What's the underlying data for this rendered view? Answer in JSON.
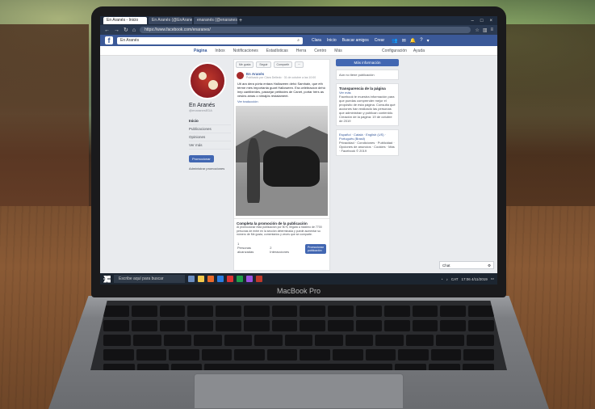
{
  "browser": {
    "tabs": [
      {
        "label": "En Aranés - Inicio",
        "active": true
      },
      {
        "label": "En Aranés (@EnAranes) / Twi…",
        "active": false
      },
      {
        "label": "enaranés (@enaranes) • Inst…",
        "active": false
      }
    ],
    "new_tab": "+",
    "url": "https://www.facebook.com/enaranes/",
    "controls": [
      "–",
      "□",
      "×"
    ]
  },
  "facebook": {
    "logo": "f",
    "search_value": "En Aranés",
    "nav": [
      "Clara",
      "Inicio",
      "Buscar amigos",
      "Crear"
    ],
    "page_tabs": [
      "Página",
      "Inbox",
      "Notificaciones",
      "Estadísticas",
      "Herramientas de publicación",
      "Más"
    ],
    "page_tabs_short": [
      "Página",
      "Inbox",
      "Notificaciones",
      "Estadísticas",
      "Herra",
      "Centro",
      "Más"
    ],
    "page_tabs_right": [
      "Configuración",
      "Ayuda"
    ],
    "page_name": "En Aranés",
    "handle": "@enaranesEDA",
    "left_nav": [
      "Inicio",
      "Publicaciones",
      "Opiniones",
      "Ver más"
    ],
    "promote_label": "Promocionar",
    "admin_promos": "Administrar promociones",
    "post_actions": [
      "Me gusta",
      "Seguir",
      "Compartir",
      "···"
    ],
    "post_author": "En Aranés",
    "post_meta": "Publicado por Clara Delledo · 31 de octubre a las 10:00",
    "post_text": "Uti ara dera pòrta entara Halloween dehò Samhain, que eth tèrme més importanta guart Halloween. Era celebracion dehò irep cantibirides, passejar petitòdes de Canet, portar hèrs as vesins amas o nimajós restalament.",
    "post_link": "Ver traducción",
    "promo_title": "Completa la promoción de la publicación",
    "promo_desc": "Al promocionar esta publicación por 50 €, llegará a máximo de 7700 personas de entre en la sección determinada y puede aumentar su número de Me gusta, comentarios y veces que se comparte.",
    "stats": [
      {
        "value": "1",
        "label": "Personas alcanzadas"
      },
      {
        "value": "2",
        "label": "Interacciones"
      }
    ],
    "promote_post_label": "Promocionar publicación",
    "more_info": "Más información",
    "right_cards": [
      {
        "title": "",
        "text": "Aún no tiene publicación"
      },
      {
        "title": "Transparencia de la página",
        "link": "Ver más",
        "text": "Facebook te muestra información para que puedas comprender mejor el propósito de esta página. Consulta qué acciones han realizado las personas que administran y publican contenido.",
        "extra": "Creación de la página: 19 de octubre de 2019"
      },
      {
        "title": "",
        "text": "Español · Català · English (US) · Português (Brasil)",
        "extra": "Privacidad · Condiciones · Publicidad · Opciones de anuncios · Cookies · Más · Facebook © 2019"
      }
    ],
    "chat_label": "Chat"
  },
  "taskbar": {
    "search_placeholder": "Escribe aquí para buscar",
    "tray_lang": "CAT",
    "time": "17:06",
    "date": "4/11/2019"
  },
  "hardware": {
    "brand": "MacBook Pro"
  },
  "colors": {
    "facebook_blue": "#3b5998",
    "button_blue": "#4267b2",
    "link_blue": "#365899",
    "avatar_red": "#a52a2a"
  }
}
